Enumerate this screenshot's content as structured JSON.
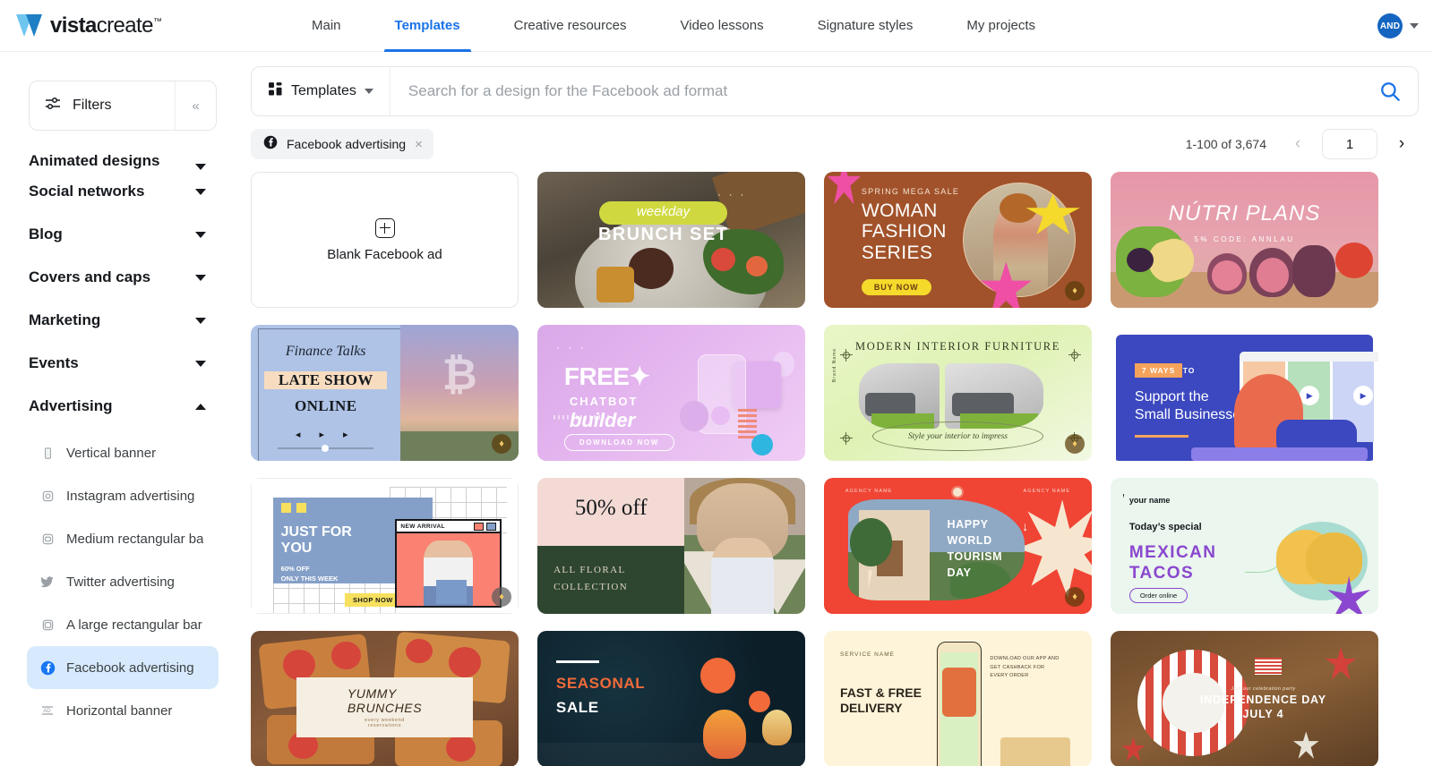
{
  "brand": {
    "name_bold": "vista",
    "name_light": "create",
    "tm": "™"
  },
  "topnav": {
    "items": [
      {
        "label": "Main",
        "active": false
      },
      {
        "label": "Templates",
        "active": true
      },
      {
        "label": "Creative resources",
        "active": false
      },
      {
        "label": "Video lessons",
        "active": false
      },
      {
        "label": "Signature styles",
        "active": false
      },
      {
        "label": "My projects",
        "active": false
      }
    ],
    "avatar_initials": "AND"
  },
  "sidebar": {
    "filters_label": "Filters",
    "collapse_glyph": "«",
    "categories": [
      {
        "label": "Animated designs",
        "expanded": false
      },
      {
        "label": "Social networks",
        "expanded": false
      },
      {
        "label": "Blog",
        "expanded": false
      },
      {
        "label": "Covers and caps",
        "expanded": false
      },
      {
        "label": "Marketing",
        "expanded": false
      },
      {
        "label": "Events",
        "expanded": false
      },
      {
        "label": "Advertising",
        "expanded": true
      }
    ],
    "advertising_items": [
      {
        "label": "Vertical banner",
        "icon": "vertical-banner-icon",
        "selected": false
      },
      {
        "label": "Instagram advertising",
        "icon": "instagram-icon",
        "selected": false
      },
      {
        "label": "Medium rectangular ba",
        "icon": "medium-rectangle-icon",
        "selected": false
      },
      {
        "label": "Twitter advertising",
        "icon": "twitter-icon",
        "selected": false
      },
      {
        "label": "A large rectangular bar",
        "icon": "large-rectangle-icon",
        "selected": false
      },
      {
        "label": "Facebook advertising",
        "icon": "facebook-icon",
        "selected": true
      },
      {
        "label": "Horizontal banner",
        "icon": "horizontal-banner-icon",
        "selected": false
      }
    ]
  },
  "search": {
    "kind_label": "Templates",
    "placeholder": "Search for a design for the Facebook ad format",
    "value": ""
  },
  "filter_chip": {
    "label": "Facebook advertising",
    "remove_glyph": "×"
  },
  "pagination": {
    "count_text": "1-100 of 3,674",
    "prev_glyph": "‹",
    "next_glyph": "›",
    "current_page": "1"
  },
  "blank_card": {
    "label": "Blank Facebook ad"
  },
  "templates": [
    {
      "id": "brunch",
      "name": "weekday-brunch-set",
      "script": "weekday",
      "headline": "BRUNCH SET",
      "dots": "· · ·",
      "pro": false
    },
    {
      "id": "fashion",
      "name": "woman-fashion-series",
      "kicker": "SPRING MEGA SALE",
      "headline": "WOMAN\nFASHION\nSERIES",
      "cta": "BUY NOW",
      "pro": true
    },
    {
      "id": "nutri",
      "name": "nutri-plans",
      "headline": "NÚTRI PLANS",
      "sub": "5% CODE: ANNLAU",
      "pro": false
    },
    {
      "id": "finance",
      "name": "finance-talks-late-show",
      "italic": "Finance Talks",
      "line1": "LATE SHOW",
      "line2": "ONLINE",
      "controls": "◂ ▸ ▸",
      "pro": true
    },
    {
      "id": "chatbot",
      "name": "free-chatbot-builder",
      "word1": "FREE✦",
      "word2": "CHATBOT",
      "word3": "builder",
      "cta": "DOWNLOAD NOW",
      "dots": "· · ·",
      "pro": false
    },
    {
      "id": "furniture",
      "name": "modern-interior-furniture",
      "headline": "MODERN  INTERIOR  FURNITURE",
      "caption": "Style your interior to impress",
      "vertical_note": "Brand Name",
      "pro": true
    },
    {
      "id": "smallbiz",
      "name": "support-small-businesses",
      "tag": "7 WAYS",
      "tag_to": "TO",
      "headline": "Support the\nSmall Businesses",
      "pro": false
    },
    {
      "id": "justforyou",
      "name": "just-for-you-shop-now",
      "headline": "JUST FOR\nYOU",
      "sub": "60% OFF\nONLY THIS WEEK",
      "cta": "SHOP NOW",
      "window_title": "NEW ARRIVAL",
      "pro": true
    },
    {
      "id": "floral",
      "name": "fifty-percent-off-floral",
      "headline": "50% off",
      "sub": "ALL FLORAL\nCOLLECTION",
      "pro": false
    },
    {
      "id": "tourism",
      "name": "happy-world-tourism-day",
      "agency_left": "AGENCY NAME",
      "agency_right": "AGENCY NAME",
      "headline": "HAPPY\nWORLD\nTOURISM\nDAY",
      "arrow": "↓",
      "pro": true
    },
    {
      "id": "tacos",
      "name": "mexican-tacos-todays-special",
      "your_name": "your name",
      "today": "Today’s special",
      "headline": "MEXICAN\nTACOS",
      "cta": "Order online",
      "pro": false
    },
    {
      "id": "yummy",
      "name": "yummy-brunches",
      "headline": "YUMMY\nBRUNCHES",
      "sub": "every weekend\nreservations",
      "pro": false
    },
    {
      "id": "seasonal",
      "name": "seasonal-sale",
      "line1": "SEASONAL",
      "line2": "SALE",
      "pro": false
    },
    {
      "id": "delivery",
      "name": "fast-free-delivery",
      "service": "SERVICE NAME",
      "headline": "FAST & FREE\nDELIVERY",
      "copy": "DOWNLOAD OUR APP AND\nGET CASHBACK FOR\nEVERY ORDER",
      "pro": false
    },
    {
      "id": "independence",
      "name": "independence-day-july-4",
      "kicker": "Join our celebration party",
      "line1": "INDEPENDENCE DAY",
      "line2": "JULY 4",
      "pro": false
    }
  ],
  "colors": {
    "accent": "#1a73e8",
    "selected_bg": "#d7eafd",
    "facebook": "#1877f2",
    "border": "#e4e6e9",
    "muted_text": "#9aa0a6"
  }
}
